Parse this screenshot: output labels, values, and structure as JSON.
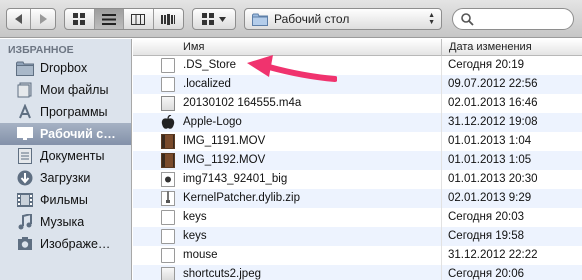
{
  "toolbar": {
    "path_label": "Рабочий стол"
  },
  "sidebar": {
    "section_title": "ИЗБРАННОЕ",
    "items": [
      {
        "label": "Dropbox",
        "icon": "dropbox-folder-icon"
      },
      {
        "label": "Мои файлы",
        "icon": "all-files-icon"
      },
      {
        "label": "Программы",
        "icon": "applications-icon"
      },
      {
        "label": "Рабочий с…",
        "icon": "desktop-icon",
        "selected": true
      },
      {
        "label": "Документы",
        "icon": "documents-icon"
      },
      {
        "label": "Загрузки",
        "icon": "downloads-icon"
      },
      {
        "label": "Фильмы",
        "icon": "movies-icon"
      },
      {
        "label": "Музыка",
        "icon": "music-icon"
      },
      {
        "label": "Изображе…",
        "icon": "pictures-icon"
      }
    ]
  },
  "list": {
    "columns": {
      "name": "Имя",
      "date": "Дата изменения"
    },
    "rows": [
      {
        "name": ".DS_Store",
        "date": "Сегодня 20:19",
        "type": "doc"
      },
      {
        "name": ".localized",
        "date": "09.07.2012 22:56",
        "type": "doc"
      },
      {
        "name": "20130102 164555.m4a",
        "date": "02.01.2013 16:46",
        "type": "audio"
      },
      {
        "name": "Apple-Logo",
        "date": "31.12.2012 19:08",
        "type": "apple"
      },
      {
        "name": "IMG_1191.MOV",
        "date": "01.01.2013 1:04",
        "type": "movie"
      },
      {
        "name": "IMG_1192.MOV",
        "date": "01.01.2013 1:05",
        "type": "movie"
      },
      {
        "name": "img7143_92401_big",
        "date": "01.01.2013 20:30",
        "type": "image"
      },
      {
        "name": "KernelPatcher.dylib.zip",
        "date": "02.01.2013 9:29",
        "type": "zip"
      },
      {
        "name": "keys",
        "date": "Сегодня 20:03",
        "type": "doc"
      },
      {
        "name": "keys",
        "date": "Сегодня 19:58",
        "type": "doc"
      },
      {
        "name": "mouse",
        "date": "31.12.2012 22:22",
        "type": "doc"
      },
      {
        "name": "shortcuts2.jpeg",
        "date": "Сегодня 20:06",
        "type": "jpg"
      }
    ]
  },
  "colors": {
    "arrow": "#f0336e",
    "sidebar_bg": "#dce3ec",
    "row_alt": "#edf3fe"
  }
}
